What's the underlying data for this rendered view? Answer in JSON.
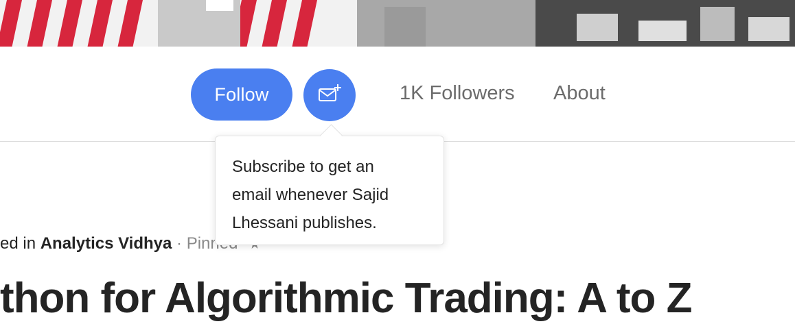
{
  "profile": {
    "follow_label": "Follow",
    "followers_label": "1K Followers",
    "about_label": "About"
  },
  "tooltip": {
    "line1": "Subscribe to get an",
    "line2": "email whenever Sajid",
    "line3": "Lhessani publishes."
  },
  "article": {
    "published_prefix": "ed in ",
    "publication": "Analytics Vidhya",
    "separator": " · ",
    "pinned_label": "Pinned",
    "title": "thon for Algorithmic Trading: A to Z"
  },
  "colors": {
    "accent": "#4a7ff0",
    "text": "#242424",
    "muted": "#6b6b6b"
  },
  "icons": {
    "subscribe": "mail-plus-icon",
    "pinned": "star-icon"
  }
}
